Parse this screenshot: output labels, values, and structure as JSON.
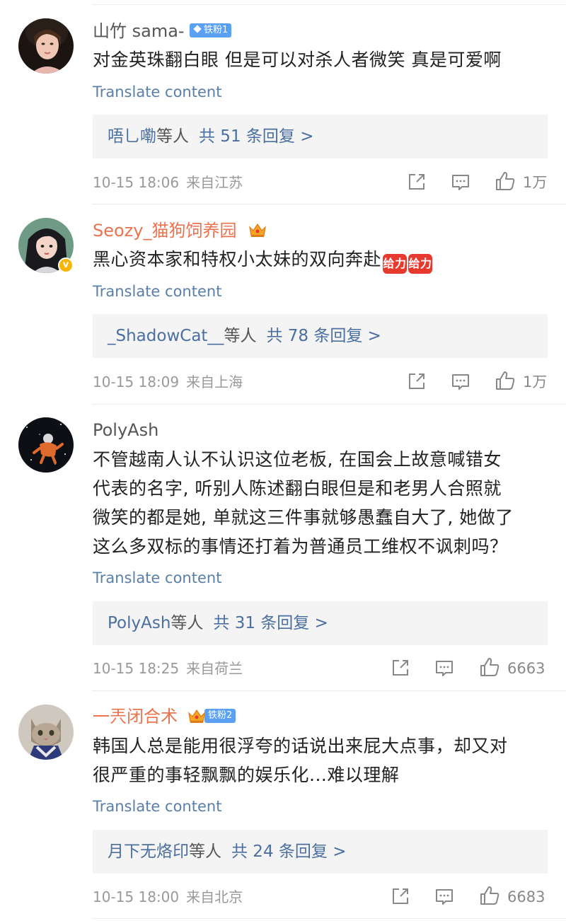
{
  "comments": [
    {
      "username": "山竹 sama-",
      "badge": "铁粉1",
      "content": "对金英珠翻白眼 但是可以对杀人者微笑 真是可爱啊",
      "translate": "Translate content",
      "reply": {
        "names": "唔乚嘞",
        "suffix": "等人",
        "count": "共 51 条回复 >"
      },
      "date": "10-15 18:06",
      "location": "来自江苏",
      "likes": "1万"
    },
    {
      "username": "Seozy_猫狗饲养园",
      "badge": "",
      "content": "黑心资本家和特权小太妹的双向奔赴",
      "emoji_label": "[加油]",
      "emoji_text": "给力",
      "translate": "Translate content",
      "reply": {
        "names": "_ShadowCat__",
        "suffix": "等人",
        "count": "共 78 条回复 >"
      },
      "date": "10-15 18:09",
      "location": "来自上海",
      "likes": "1万"
    },
    {
      "username": "PolyAsh",
      "badge": "",
      "content_lines": [
        "不管越南人认不认识这位老板, 在国会上故意喊错女",
        "代表的名字, 听别人陈述翻白眼但是和老男人合照就",
        "微笑的都是她, 单就这三件事就够愚蠢自大了, 她做了",
        "这么多双标的事情还打着为普通员工维权不讽刺吗？"
      ],
      "translate": "Translate content",
      "reply": {
        "names": "PolyAsh",
        "suffix": "等人",
        "count": "共 31 条回复 >"
      },
      "date": "10-15 18:25",
      "location": "来自荷兰",
      "likes": "6663"
    },
    {
      "username": "一兲闭合术",
      "badge": "铁粉2",
      "content_lines": [
        "韩国人总是能用很浮夸的话说出来屁大点事，却又对",
        "很严重的事轻飘飘的娱乐化...难以理解"
      ],
      "translate": "Translate content",
      "reply": {
        "names": "月下无烙印",
        "suffix": "等人",
        "count": "共 24 条回复 >"
      },
      "date": "10-15 18:00",
      "location": "来自北京",
      "likes": "6683"
    }
  ],
  "colors": {
    "link_blue": "#5a7fa8",
    "vip_orange": "#eb7350",
    "badge_blue": "#5aa1f5",
    "reply_bg": "#f4f4f4"
  },
  "icons": [
    "share-icon",
    "comment-icon",
    "like-icon",
    "crown-icon",
    "verified-icon",
    "diamond-icon"
  ]
}
